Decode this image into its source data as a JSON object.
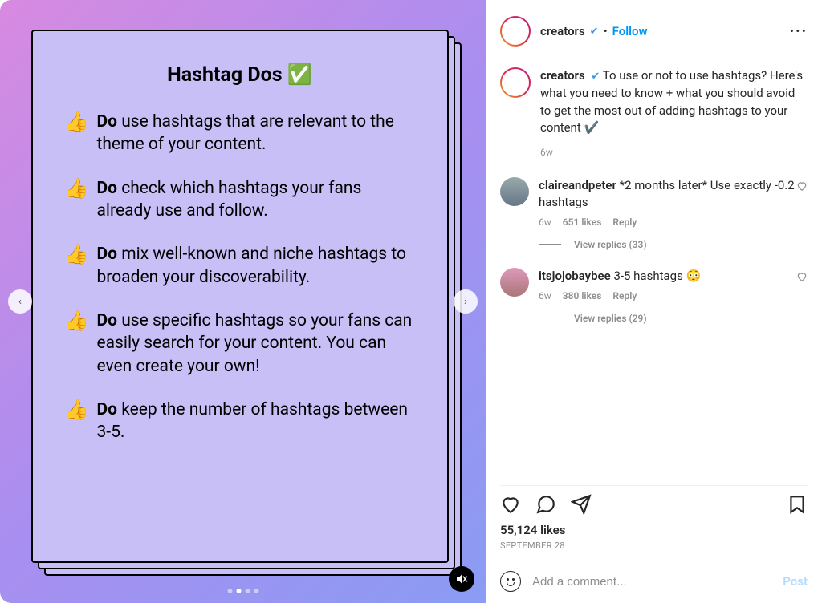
{
  "media": {
    "card_title": "Hashtag Dos ✅",
    "tips": [
      {
        "lead": "Do",
        "text": " use hashtags that are relevant to the theme of your content."
      },
      {
        "lead": "Do",
        "text": " check which hashtags your fans already use and follow."
      },
      {
        "lead": "Do",
        "text": " mix well-known and niche hashtags to broaden your discoverability."
      },
      {
        "lead": "Do",
        "text": " use specific hashtags so your fans can easily search for your content. You can even create your own!"
      },
      {
        "lead": "Do",
        "text": " keep the number of hashtags between 3-5."
      }
    ],
    "thumb_emoji": "👍",
    "carousel": {
      "count": 4,
      "active_index": 1
    }
  },
  "post": {
    "username": "creators",
    "verified": true,
    "follow_label": "Follow",
    "caption": "To use or not to use hashtags? Here's what you need to know + what you should avoid to get the most out of adding hashtags to your content ✔️",
    "age": "6w",
    "likes_label": "55,124 likes",
    "date_label": "SEPTEMBER 28"
  },
  "comments": [
    {
      "username": "claireandpeter",
      "text": "*2 months later* Use exactly -0.2 hashtags",
      "age": "6w",
      "likes": "651 likes",
      "reply_label": "Reply",
      "view_replies": "View replies (33)"
    },
    {
      "username": "itsjojobaybee",
      "text": "3-5 hashtags 😳",
      "age": "6w",
      "likes": "380 likes",
      "reply_label": "Reply",
      "view_replies": "View replies (29)"
    }
  ],
  "composer": {
    "placeholder": "Add a comment...",
    "post_label": "Post"
  }
}
